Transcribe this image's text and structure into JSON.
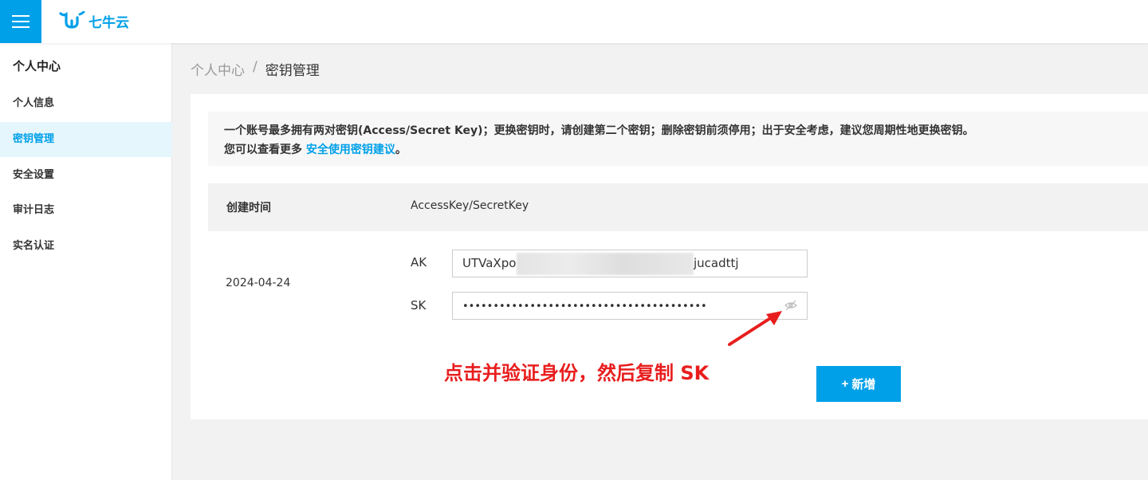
{
  "header": {
    "logo_text": "七牛云",
    "brand_color": "#00a0e9"
  },
  "sidebar": {
    "title": "个人中心",
    "items": [
      {
        "label": "个人信息"
      },
      {
        "label": "密钥管理",
        "active": true
      },
      {
        "label": "安全设置"
      },
      {
        "label": "审计日志"
      },
      {
        "label": "实名认证"
      }
    ]
  },
  "breadcrumb": {
    "parent": "个人中心",
    "separator": "/",
    "current": "密钥管理"
  },
  "notice": {
    "line1": "一个账号最多拥有两对密钥(Access/Secret Key)；更换密钥时，请创建第二个密钥；删除密钥前须停用；出于安全考虑，建议您周期性地更换密钥。",
    "line2_prefix": "您可以查看更多 ",
    "link_text": "安全使用密钥建议",
    "line2_suffix": "。"
  },
  "table": {
    "headers": [
      "创建时间",
      "AccessKey/SecretKey"
    ],
    "row": {
      "date": "2024-04-24",
      "ak_label": "AK",
      "ak_visible_start": "UTVaXpo",
      "ak_visible_end": "jucadttj",
      "sk_label": "SK",
      "sk_masked": "••••••••••••••••••••••••••••••••••••••••"
    }
  },
  "annotation": {
    "text": "点击并验证身份，然后复制 SK",
    "color": "#e81e1e"
  },
  "actions": {
    "add_label": "新增",
    "add_icon": "+"
  }
}
